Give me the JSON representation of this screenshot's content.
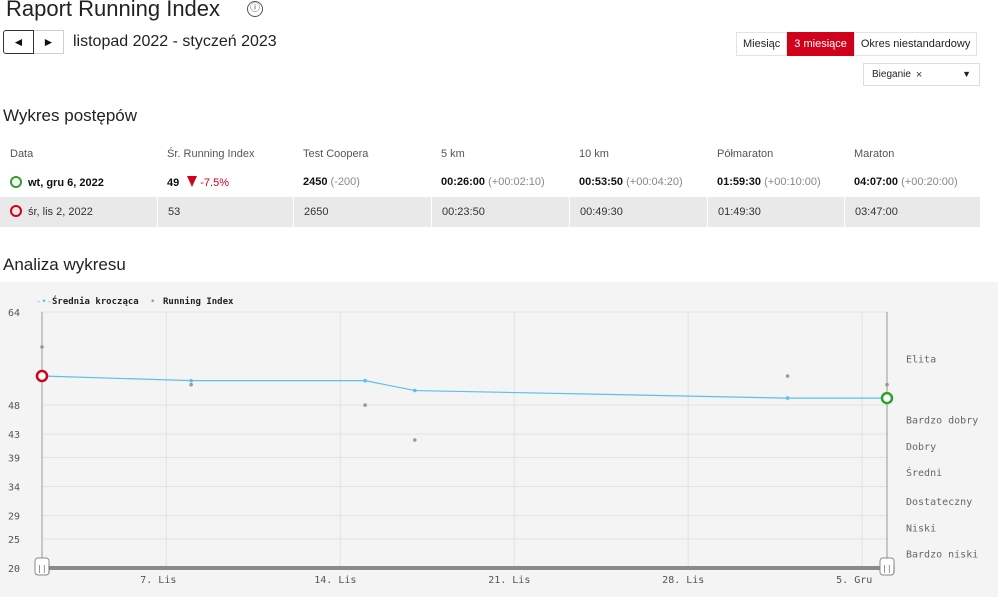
{
  "header": {
    "title": "Raport Running Index",
    "info_icon": "ⓘ",
    "prev_icon": "◄",
    "next_icon": "►",
    "period": "listopad 2022 - styczeń 2023"
  },
  "range_tabs": [
    {
      "label": "Miesiąc",
      "active": false
    },
    {
      "label": "3 miesiące",
      "active": true
    },
    {
      "label": "Okres niestandardowy",
      "active": false
    }
  ],
  "sport_filter": {
    "chip": "Bieganie",
    "remove": "×",
    "caret": "▼"
  },
  "progress": {
    "title": "Wykres postępów",
    "columns": [
      "Data",
      "Śr. Running Index",
      "Test Coopera",
      "5 km",
      "10 km",
      "Półmaraton",
      "Maraton"
    ],
    "rows": [
      {
        "date": "wt, gru 6, 2022",
        "ri": "49",
        "ri_delta": "-7.5%",
        "cooper": "2450",
        "cooper_delta": "(-200)",
        "k5": "00:26:00",
        "k5_delta": "(+00:02:10)",
        "k10": "00:53:50",
        "k10_delta": "(+00:04:20)",
        "half": "01:59:30",
        "half_delta": "(+00:10:00)",
        "marathon": "04:07:00",
        "marathon_delta": "(+00:20:00)",
        "marker_color": "#2ea02e"
      },
      {
        "date": "śr, lis 2, 2022",
        "ri": "53",
        "cooper": "2650",
        "k5": "00:23:50",
        "k10": "00:49:30",
        "half": "01:49:30",
        "marathon": "03:47:00",
        "marker_color": "#d0021b"
      }
    ]
  },
  "analysis_title": "Analiza wykresu",
  "chart_data": {
    "type": "line",
    "legend": {
      "moving_avg": "Średnia krocząca",
      "running_index": "Running Index",
      "marker_moving": "-•-",
      "marker_ri": "•"
    },
    "y_ticks": [
      20,
      25,
      29,
      34,
      39,
      43,
      48,
      64
    ],
    "x_ticks": [
      "7. Lis",
      "14. Lis",
      "21. Lis",
      "28. Lis",
      "5. Gru"
    ],
    "ylim": [
      20,
      64
    ],
    "x_days_range": [
      2,
      36
    ],
    "levels": [
      {
        "label": "Elita",
        "y": 56
      },
      {
        "label": "Bardzo dobry",
        "y": 45.5
      },
      {
        "label": "Dobry",
        "y": 41
      },
      {
        "label": "Średni",
        "y": 36.5
      },
      {
        "label": "Dostateczny",
        "y": 31.5
      },
      {
        "label": "Niski",
        "y": 27
      },
      {
        "label": "Bardzo niski",
        "y": 22.5
      }
    ],
    "series": [
      {
        "name": "Średnia krocząca",
        "color": "#5bc0eb",
        "x": [
          2,
          8,
          15,
          17,
          32,
          36
        ],
        "y": [
          53,
          52.2,
          52.2,
          50.5,
          49.2,
          49.2
        ]
      },
      {
        "name": "Running Index",
        "color": "#999999",
        "x": [
          2,
          8,
          15,
          17,
          32,
          36
        ],
        "y": [
          58,
          51.5,
          48,
          42,
          53,
          51.5
        ]
      }
    ],
    "start_marker_color": "#d0021b",
    "end_marker_color": "#2ea02e",
    "handle_label": "|||"
  }
}
